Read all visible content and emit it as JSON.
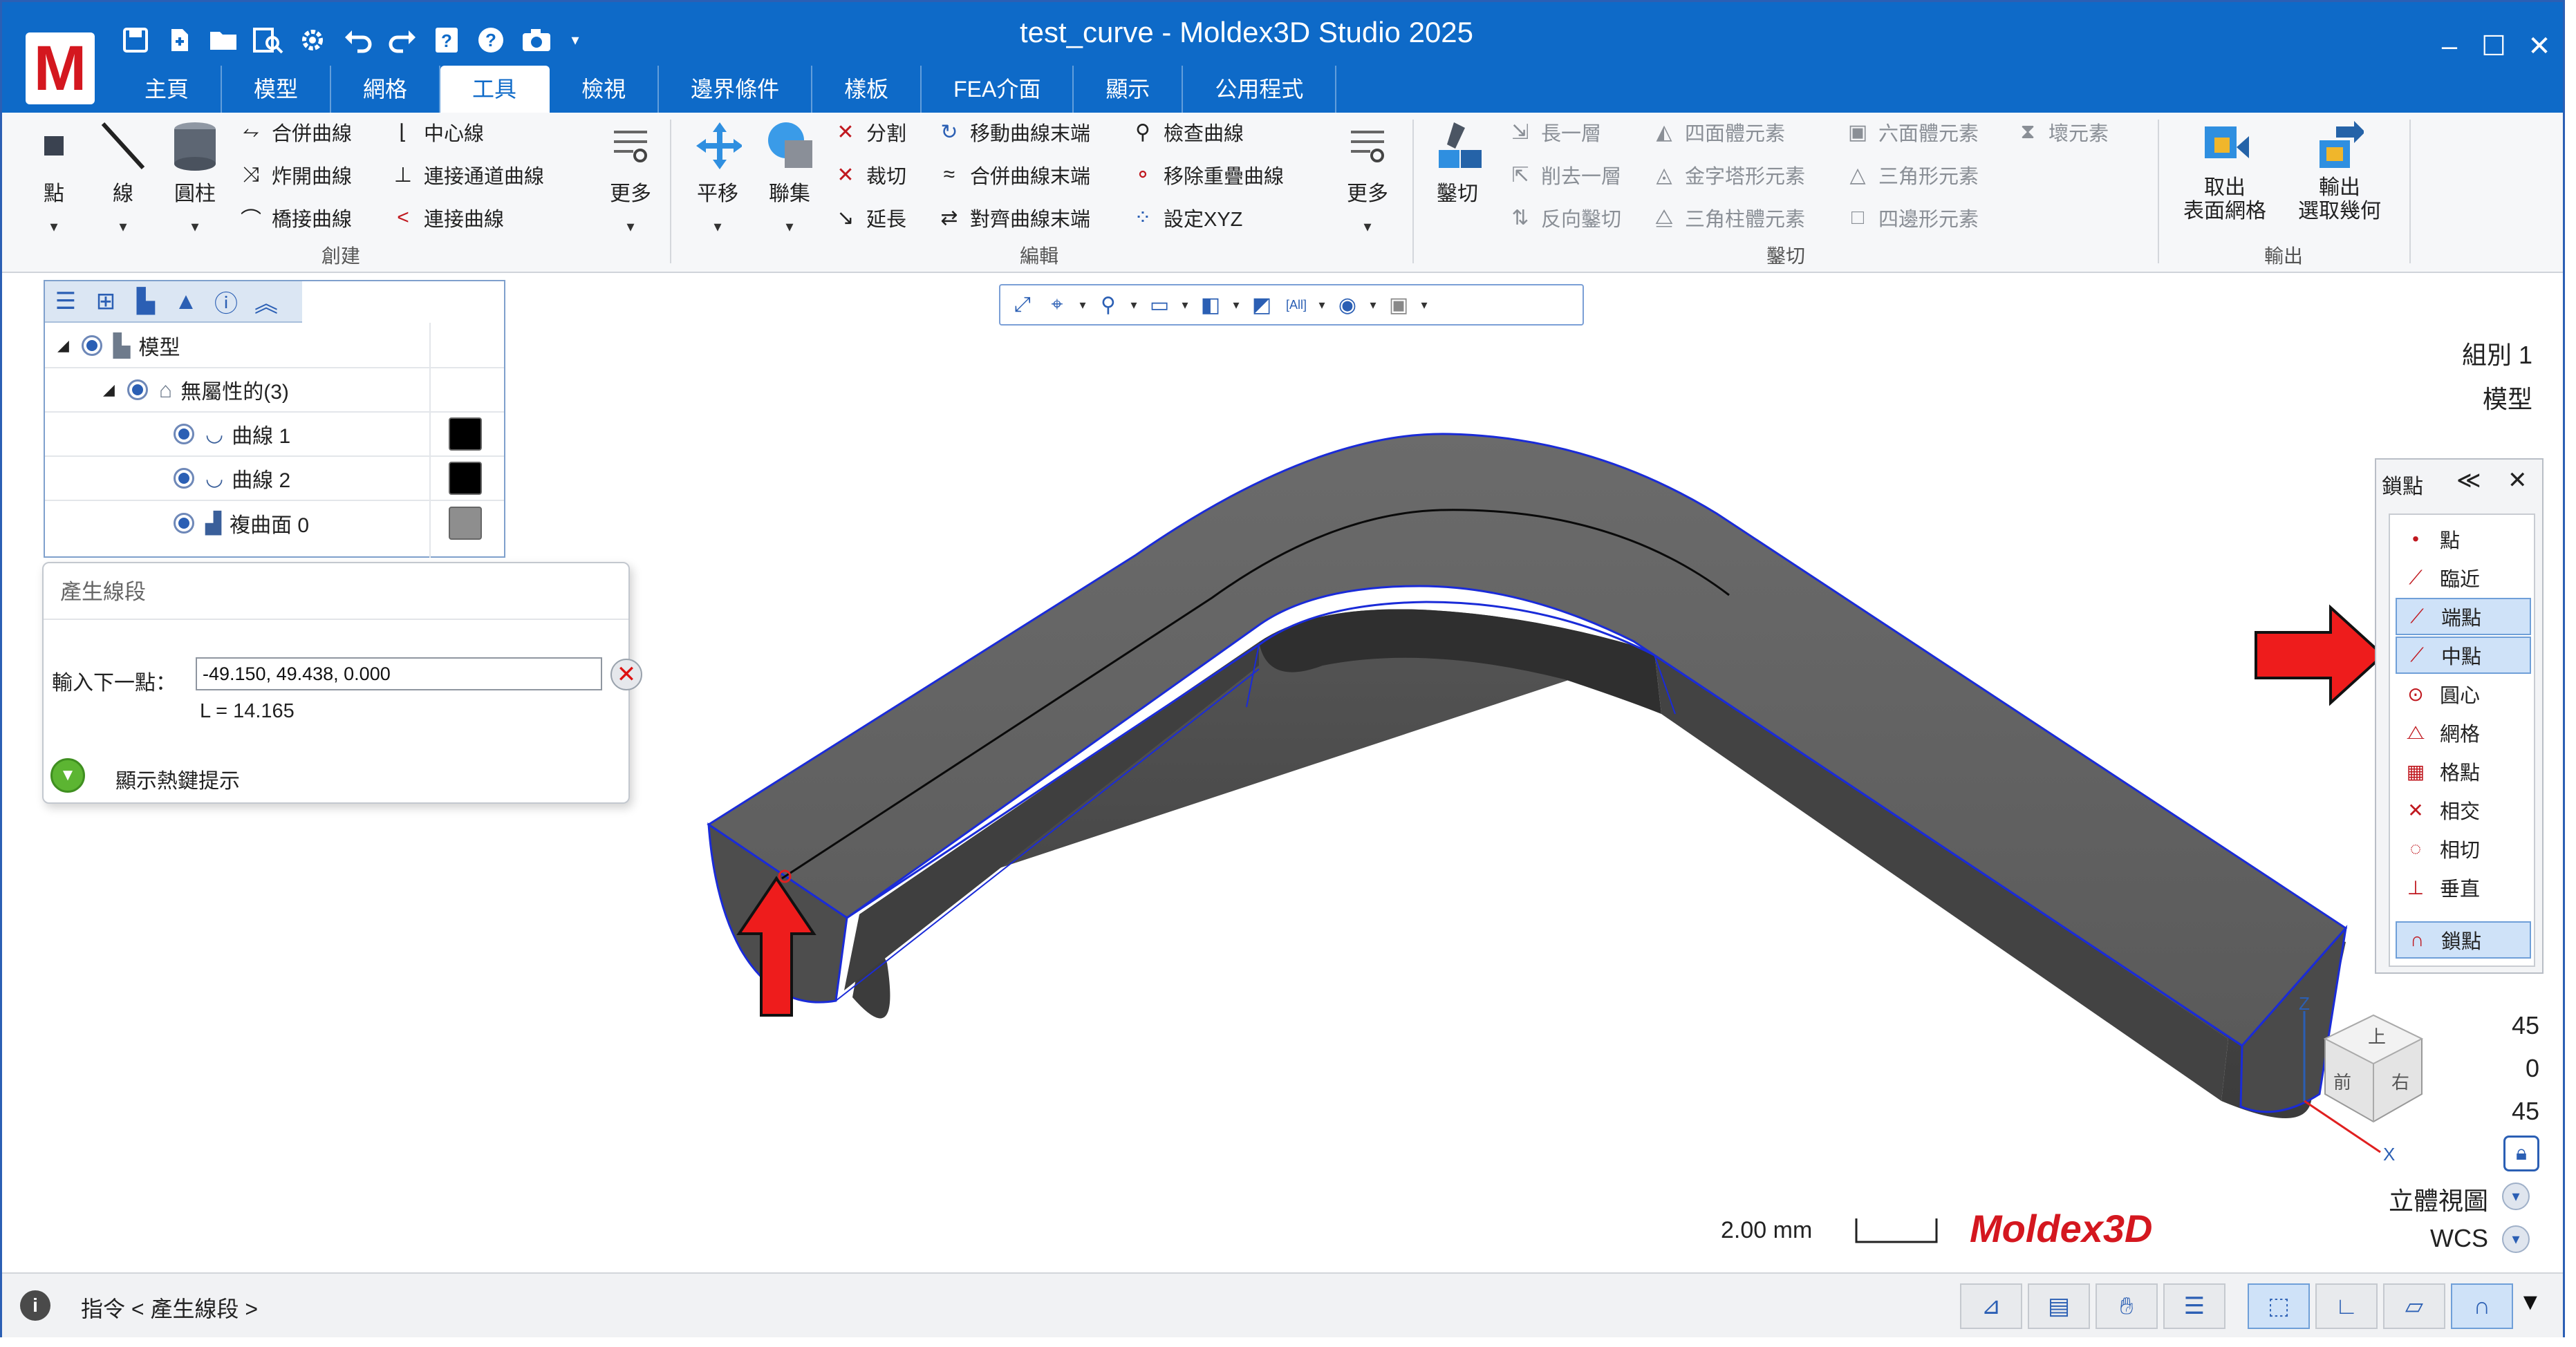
{
  "app": {
    "title": "test_curve - Moldex3D Studio 2025",
    "logo_letter": "M",
    "brand_color": "#0e6ac8",
    "accent_red": "#d4171f"
  },
  "quick_access": [
    "save-icon",
    "new-icon",
    "open-icon",
    "find-icon",
    "gear-icon",
    "undo-icon",
    "redo-icon",
    "help-page-icon",
    "help-icon",
    "camera-icon"
  ],
  "window_controls": [
    "minimize",
    "maximize",
    "close"
  ],
  "tabs": [
    {
      "label": "主頁"
    },
    {
      "label": "模型"
    },
    {
      "label": "網格"
    },
    {
      "label": "工具",
      "active": true
    },
    {
      "label": "檢視"
    },
    {
      "label": "邊界條件"
    },
    {
      "label": "樣板"
    },
    {
      "label": "FEA介面"
    },
    {
      "label": "顯示"
    },
    {
      "label": "公用程式"
    }
  ],
  "ribbon": {
    "create": {
      "label": "創建",
      "big": [
        {
          "label": "點"
        },
        {
          "label": "線"
        },
        {
          "label": "圓柱"
        }
      ],
      "small": [
        {
          "label": "合併曲線"
        },
        {
          "label": "炸開曲線"
        },
        {
          "label": "橋接曲線"
        },
        {
          "label": "中心線"
        },
        {
          "label": "連接通道曲線"
        },
        {
          "label": "連接曲線"
        }
      ],
      "more": "更多"
    },
    "edit": {
      "label": "編輯",
      "big": [
        {
          "label": "平移"
        },
        {
          "label": "聯集"
        }
      ],
      "small": [
        {
          "label": "分割"
        },
        {
          "label": "裁切"
        },
        {
          "label": "延長"
        },
        {
          "label": "移動曲線末端"
        },
        {
          "label": "合併曲線末端"
        },
        {
          "label": "對齊曲線末端"
        },
        {
          "label": "檢查曲線"
        },
        {
          "label": "移除重疊曲線"
        },
        {
          "label": "設定XYZ"
        }
      ],
      "more": "更多"
    },
    "cut": {
      "label": "鑿切",
      "big": [
        {
          "label": "鑿切"
        }
      ],
      "small": [
        {
          "label": "長一層"
        },
        {
          "label": "削去一層"
        },
        {
          "label": "反向鑿切"
        },
        {
          "label": "四面體元素"
        },
        {
          "label": "金字塔形元素"
        },
        {
          "label": "三角柱體元素"
        },
        {
          "label": "六面體元素"
        },
        {
          "label": "三角形元素"
        },
        {
          "label": "四邊形元素"
        },
        {
          "label": "壞元素"
        }
      ]
    },
    "output": {
      "label": "輸出",
      "big": [
        {
          "label": "取出\n表面網格"
        },
        {
          "label": "輸出\n選取幾何"
        }
      ]
    }
  },
  "view_toolbar": [
    "fit-icon",
    "center-icon",
    "zoom-icon",
    "window-icon",
    "box-icon",
    "plane-icon",
    "all-icon",
    "eye-icon",
    "layer-icon"
  ],
  "tree": {
    "tabs": [
      "list-icon",
      "tree-icon",
      "parts-icon",
      "cone-icon",
      "info-icon",
      "collapse-icon"
    ],
    "rows": [
      {
        "label": "模型",
        "level": 0
      },
      {
        "label": "無屬性的(3)",
        "level": 1
      },
      {
        "label": "曲線 1",
        "level": 2,
        "color": "#000000"
      },
      {
        "label": "曲線 2",
        "level": 2,
        "color": "#000000"
      },
      {
        "label": "複曲面 0",
        "level": 2,
        "color": "#8e8e8e"
      }
    ]
  },
  "segment_panel": {
    "title": "產生線段",
    "input_label": "輸入下一點：",
    "input_value": "-49.150, 49.438, 0.000",
    "length_text": "L = 14.165",
    "hint": "顯示熱鍵提示"
  },
  "snap_panel": {
    "title": "鎖點",
    "items": [
      {
        "label": "點",
        "icon": "dot-icon",
        "on": false
      },
      {
        "label": "臨近",
        "icon": "near-icon",
        "on": false
      },
      {
        "label": "端點",
        "icon": "endpoint-icon",
        "on": true
      },
      {
        "label": "中點",
        "icon": "midpoint-icon",
        "on": true
      },
      {
        "label": "圓心",
        "icon": "center-icon",
        "on": false
      },
      {
        "label": "網格",
        "icon": "mesh-icon",
        "on": false
      },
      {
        "label": "格點",
        "icon": "grid-icon",
        "on": false
      },
      {
        "label": "相交",
        "icon": "intersect-icon",
        "on": false
      },
      {
        "label": "相切",
        "icon": "tangent-icon",
        "on": false
      },
      {
        "label": "垂直",
        "icon": "perpendicular-icon",
        "on": false
      },
      {
        "label": "鎖點",
        "icon": "magnet-icon",
        "on": true
      }
    ]
  },
  "viewport": {
    "group_label": "組別 1",
    "model_label": "模型",
    "angles": [
      "45",
      "0",
      "45"
    ],
    "view_mode": "立體視圖",
    "coord_sys": "WCS",
    "scale_text": "2.00 mm",
    "watermark": "Moldex3D",
    "axis_labels": {
      "z": "Z",
      "x": "X"
    },
    "cube_faces": [
      "上",
      "前",
      "右"
    ],
    "model_color": "#5f5f5f",
    "edge_color": "#1a2bd8"
  },
  "status": {
    "text": "指令 < 產生線段 >",
    "buttons": [
      "select-filter-icon",
      "save-view-icon",
      "hand-icon",
      "checklist-icon",
      "select-box-icon",
      "corner-icon",
      "plane-select-icon",
      "snap-magnet-icon"
    ]
  }
}
